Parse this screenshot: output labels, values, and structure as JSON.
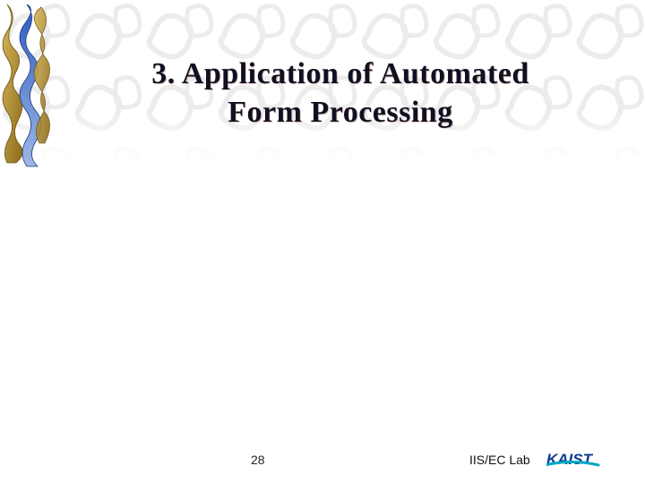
{
  "title": {
    "line1": "3. Application of Automated",
    "line2": "Form Processing"
  },
  "footer": {
    "page_number": "28",
    "lab": "IIS/EC Lab",
    "logo_text": "KAIST"
  },
  "colors": {
    "title_color": "#101020",
    "accent_blue": "#0a3b8f",
    "logo_cyan": "#00a7c4",
    "ornament_gold": "#b08b2e"
  }
}
